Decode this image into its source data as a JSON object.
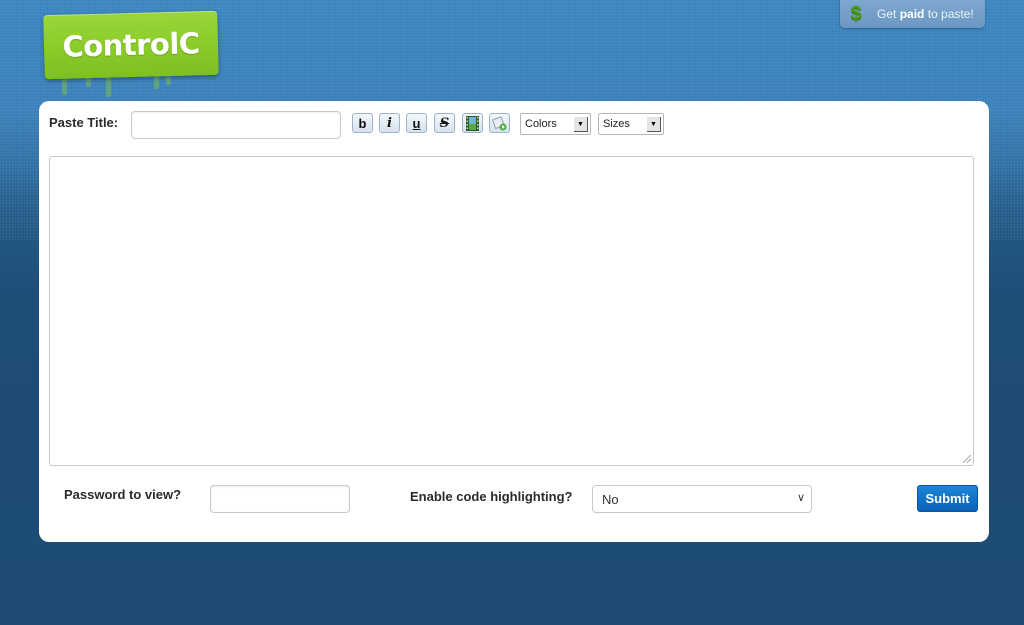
{
  "header": {
    "logo_text": "ControlC",
    "promo": {
      "icon": "dollar-icon",
      "text_before": "Get",
      "text_bold": "paid",
      "text_after": "to paste!"
    }
  },
  "form": {
    "title_label": "Paste Title:",
    "title_value": "",
    "toolbar": {
      "bold": "b",
      "italic": "i",
      "underline": "u",
      "strike": "S",
      "video_icon": "film-icon",
      "image_icon": "image-icon",
      "colors_label": "Colors",
      "sizes_label": "Sizes"
    },
    "content_value": "",
    "password_label": "Password to view?",
    "password_value": "",
    "highlight_label": "Enable code highlighting?",
    "highlight_selected": "No",
    "submit_label": "Submit"
  }
}
